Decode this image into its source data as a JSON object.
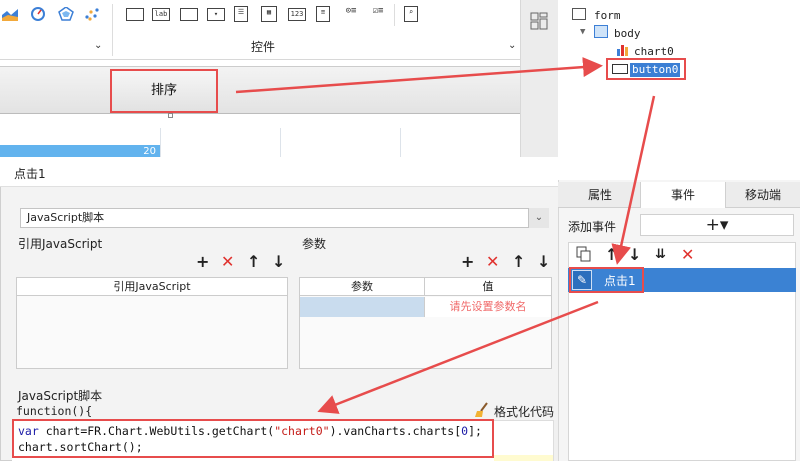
{
  "toolbar": {
    "control_icons": [
      "input-icon",
      "label-icon",
      "textarea-icon",
      "dropdown-icon",
      "checkbox-list-icon",
      "date-icon",
      "number-icon",
      "list-icon",
      "radio-group-icon",
      "checkbox-group-icon",
      "search-icon"
    ],
    "controls_label": "控件",
    "label_icon_text": "lab",
    "number_icon_text": "123"
  },
  "canvas": {
    "sort_button_label": "排序",
    "blue_cell_value": "20"
  },
  "tree": {
    "form": "form",
    "body": "body",
    "chart0": "chart0",
    "button0": "button0"
  },
  "dialog": {
    "title": "点击1",
    "script_type": "JavaScript脚本",
    "ref_js_label": "引用JavaScript",
    "params_label": "参数",
    "ref_js_header": "引用JavaScript",
    "param_header_name": "参数",
    "param_header_value": "值",
    "param_placeholder": "请先设置参数名",
    "js_script_label": "JavaScript脚本",
    "function_header": "function(){",
    "format_code": "格式化代码",
    "code": {
      "line1_kw": "var",
      "line1_a": " chart=FR.Chart.WebUtils.getChart(",
      "line1_str": "\"chart0\"",
      "line1_b": ").vanCharts.charts[",
      "line1_num": "0",
      "line1_c": "];",
      "line2": "chart.sortChart();"
    }
  },
  "right_panel": {
    "tabs": [
      "属性",
      "事件",
      "移动端"
    ],
    "add_event_label": "添加事件",
    "add_event_symbol": "+▾",
    "event_item": "点击1"
  },
  "colors": {
    "highlight_red": "#e74c4c",
    "selection_blue": "#3b82d3",
    "placeholder_red": "#f06a6a"
  }
}
